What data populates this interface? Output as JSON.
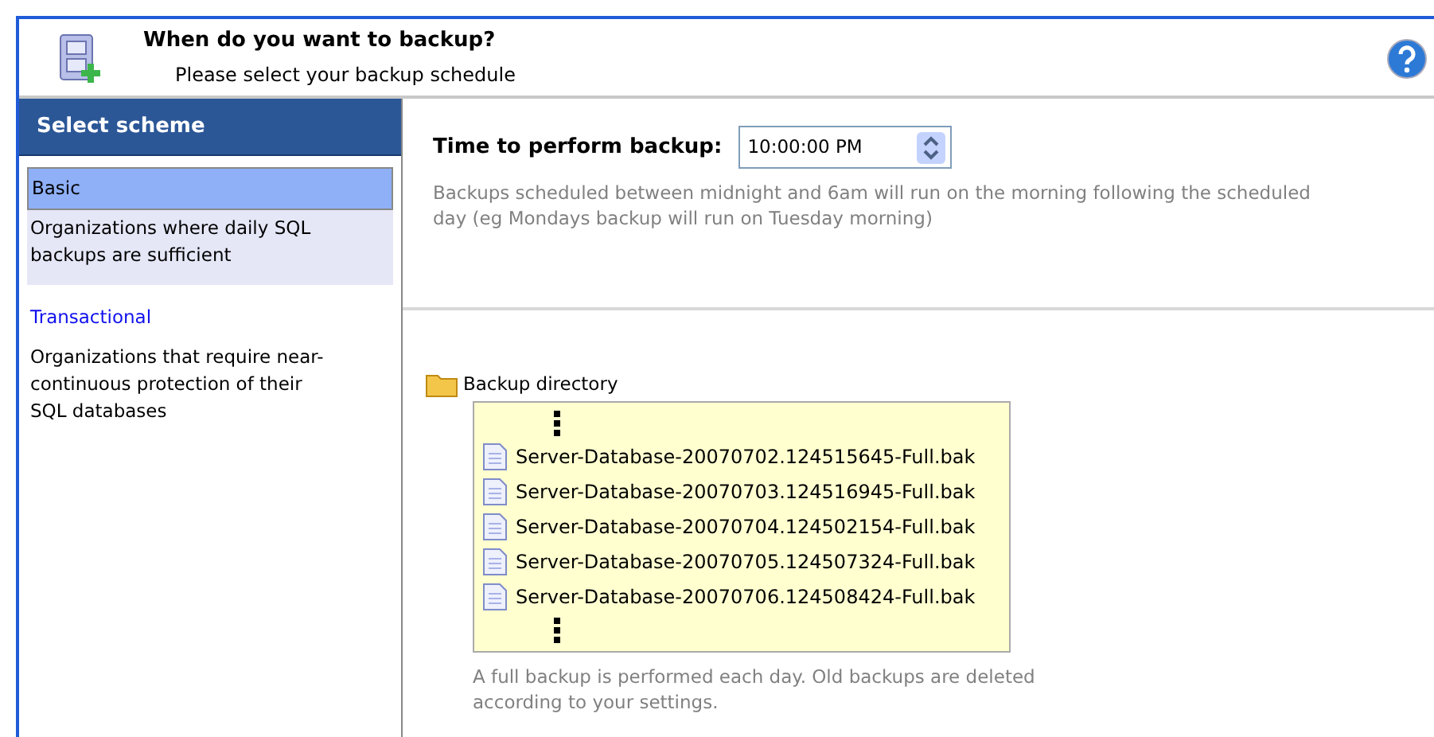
{
  "header": {
    "title": "When do you want to backup?",
    "subtitle": "Please select your backup schedule"
  },
  "sidebar": {
    "title": "Select scheme",
    "schemes": [
      {
        "name": "Basic",
        "description": "Organizations where daily SQL backups are sufficient",
        "selected": true
      },
      {
        "name": "Transactional",
        "description": "Organizations that require near-continuous protection of their SQL databases",
        "selected": false
      }
    ]
  },
  "time": {
    "label": "Time to perform backup:",
    "value": "10:00:00 PM",
    "note": "Backups scheduled between midnight and 6am will run on the morning following the scheduled day (eg Mondays backup will run on Tuesday morning)"
  },
  "directory": {
    "label": "Backup directory",
    "files": [
      "Server-Database-20070702.124515645-Full.bak",
      "Server-Database-20070703.124516945-Full.bak",
      "Server-Database-20070704.124502154-Full.bak",
      "Server-Database-20070705.124507324-Full.bak",
      "Server-Database-20070706.124508424-Full.bak"
    ],
    "note": "A full backup is performed each day.  Old backups are deleted according to your settings."
  }
}
